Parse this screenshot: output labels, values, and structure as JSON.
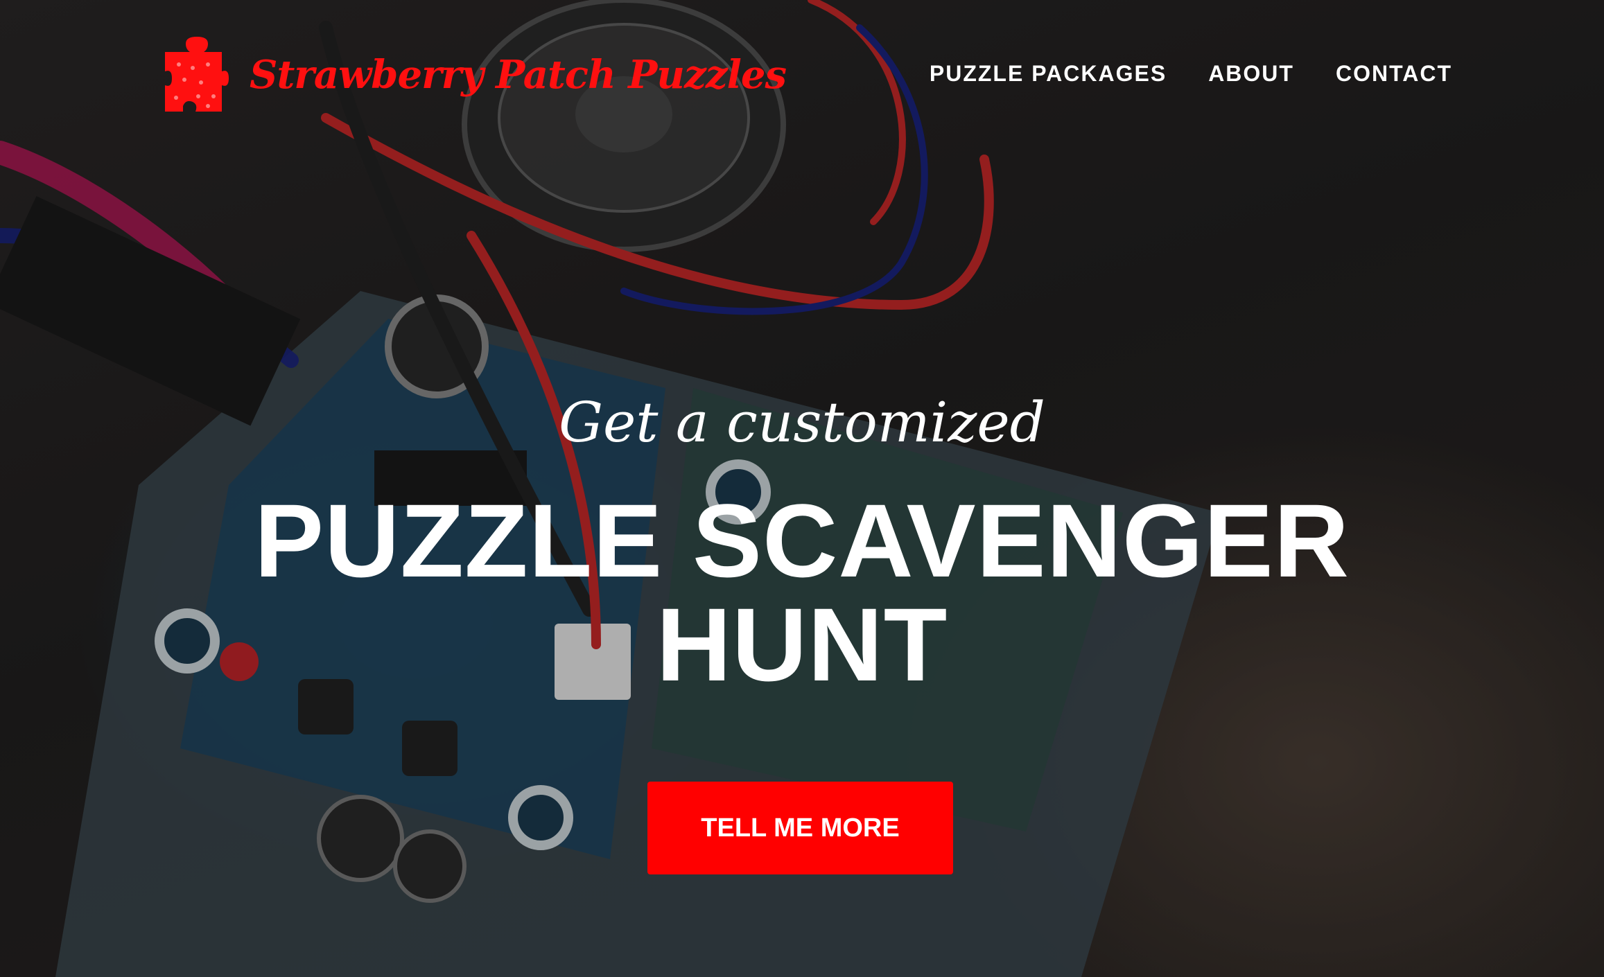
{
  "brand": {
    "name": "Strawberry Patch Puzzles",
    "logo_icon": "puzzle-piece-icon",
    "color": "#ff1010"
  },
  "nav": {
    "items": [
      {
        "label": "PUZZLE PACKAGES"
      },
      {
        "label": "ABOUT"
      },
      {
        "label": "CONTACT"
      }
    ]
  },
  "hero": {
    "subheading": "Get a customized",
    "heading": "PUZZLE SCAVENGER HUNT",
    "cta_label": "TELL ME MORE",
    "cta_color": "#ff0000"
  }
}
